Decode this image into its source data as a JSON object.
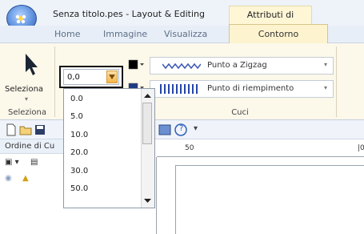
{
  "window": {
    "title": "Senza titolo.pes - Layout & Editing",
    "context_tab_header": "Attributi di cucitura"
  },
  "tabs": [
    {
      "label": "Home"
    },
    {
      "label": "Immagine"
    },
    {
      "label": "Visualizza"
    },
    {
      "label": "Contorno",
      "active": true
    }
  ],
  "ribbon": {
    "select_button": {
      "label": "Seleziona",
      "icon": "cursor-arrow-icon"
    },
    "group_select": "Seleziona",
    "group_stitch": "Cuci",
    "width_combo": {
      "value": "0,0"
    },
    "line_stitch": {
      "label": "Punto a Zigzag",
      "icon": "zigzag-icon"
    },
    "fill_stitch": {
      "label": "Punto di riempimento",
      "icon": "fill-pattern-icon"
    },
    "line_color": "#000000",
    "fill_color": "#1f3b86"
  },
  "dropdown": {
    "options": [
      "0.0",
      "5.0",
      "10.0",
      "20.0",
      "30.0",
      "50.0"
    ]
  },
  "panel": {
    "header": "Ordine di Cu"
  },
  "ruler": {
    "label_50": "50",
    "label_partial": "|0"
  },
  "quickbar": {
    "help_glyph": "?",
    "more_glyph": "▾"
  }
}
